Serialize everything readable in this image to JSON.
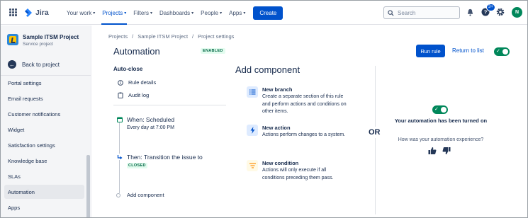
{
  "topnav": {
    "logo_text": "Jira",
    "items": [
      {
        "label": "Your work",
        "active": false
      },
      {
        "label": "Projects",
        "active": true
      },
      {
        "label": "Filters",
        "active": false
      },
      {
        "label": "Dashboards",
        "active": false
      },
      {
        "label": "People",
        "active": false
      },
      {
        "label": "Apps",
        "active": false
      }
    ],
    "create_label": "Create",
    "search_placeholder": "Search",
    "help_badge": "3+",
    "avatar_initial": "N"
  },
  "sidebar": {
    "project_name": "Sample ITSM Project",
    "project_type": "Service project",
    "back_label": "Back to project",
    "items": [
      {
        "label": "Portal settings",
        "active": false
      },
      {
        "label": "Email requests",
        "active": false
      },
      {
        "label": "Customer notifications",
        "active": false
      },
      {
        "label": "Widget",
        "active": false
      },
      {
        "label": "Satisfaction settings",
        "active": false
      },
      {
        "label": "Knowledge base",
        "active": false
      },
      {
        "label": "SLAs",
        "active": false
      },
      {
        "label": "Automation",
        "active": true
      },
      {
        "label": "Apps",
        "active": false
      }
    ]
  },
  "breadcrumbs": [
    "Projects",
    "Sample ITSM Project",
    "Project settings"
  ],
  "breadcrumb_separator": "/",
  "page": {
    "title": "Automation",
    "status_lozenge": "ENABLED",
    "run_rule_label": "Run rule",
    "return_label": "Return to list"
  },
  "rule": {
    "name": "Auto-close",
    "links": [
      {
        "label": "Rule details",
        "icon": "info-icon"
      },
      {
        "label": "Audit log",
        "icon": "clipboard-icon"
      }
    ],
    "trigger": {
      "title": "When: Scheduled",
      "subtitle": "Every day at 7:00 PM"
    },
    "action": {
      "title": "Then: Transition the issue to",
      "lozenge": "CLOSED"
    },
    "add_component_label": "Add component"
  },
  "add_component": {
    "title": "Add component",
    "options": [
      {
        "title": "New branch",
        "description": "Create a separate section of this rule and perform actions and conditions on other items.",
        "icon": "branch-icon",
        "color": "#deebff"
      },
      {
        "title": "New action",
        "description": "Actions perform changes to a system.",
        "icon": "lightning-icon",
        "color": "#deebff"
      },
      {
        "title": "New condition",
        "description": "Actions will only execute if all conditions preceding them pass.",
        "icon": "filter-icon",
        "color": "#fffae6"
      }
    ]
  },
  "or_label": "OR",
  "feedback": {
    "turned_on": "Your automation has been turned on",
    "question": "How was your automation experience?"
  },
  "colors": {
    "brand": "#0052cc",
    "success": "#00875a",
    "text": "#172b4d"
  }
}
